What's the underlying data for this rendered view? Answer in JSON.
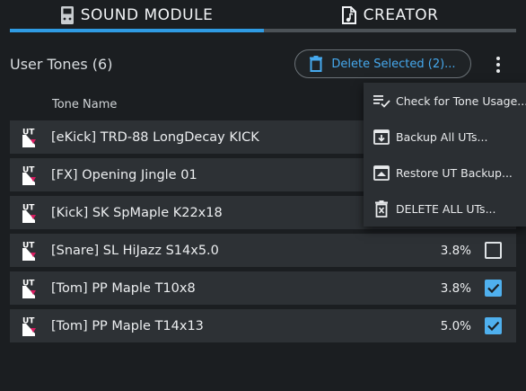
{
  "tabs": [
    {
      "label": "SOUND MODULE",
      "icon": "sound-module-icon",
      "active": true
    },
    {
      "label": "CREATOR",
      "icon": "music-file-icon",
      "active": false
    }
  ],
  "header": {
    "title": "User Tones (6)",
    "delete_button": "Delete Selected (2)...",
    "column_name": "Tone Name"
  },
  "colors": {
    "accent": "#2f9be3",
    "checkbox_checked": "#4fb0ee",
    "ut_icon_pink": "#d81b60"
  },
  "tones": [
    {
      "name": "[eKick] TRD-88 LongDecay KICK",
      "pct": "",
      "checked": false,
      "icon_text": "UT"
    },
    {
      "name": "[FX] Opening Jingle 01",
      "pct": "",
      "checked": false,
      "icon_text": "UT"
    },
    {
      "name": "[Kick] SK SpMaple K22x18",
      "pct": "",
      "checked": false,
      "icon_text": "UT"
    },
    {
      "name": "[Snare] SL HiJazz S14x5.0",
      "pct": "3.8%",
      "checked": false,
      "icon_text": "UT"
    },
    {
      "name": "[Tom] PP Maple T10x8",
      "pct": "3.8%",
      "checked": true,
      "icon_text": "UT"
    },
    {
      "name": "[Tom] PP Maple T14x13",
      "pct": "5.0%",
      "checked": true,
      "icon_text": "UT"
    }
  ],
  "menu": [
    {
      "label": "Check for Tone Usage...",
      "icon": "checklist-icon"
    },
    {
      "label": "Backup All UTs...",
      "icon": "backup-icon"
    },
    {
      "label": "Restore UT Backup...",
      "icon": "restore-icon"
    },
    {
      "label": "DELETE ALL UTs...",
      "icon": "delete-all-icon"
    }
  ]
}
